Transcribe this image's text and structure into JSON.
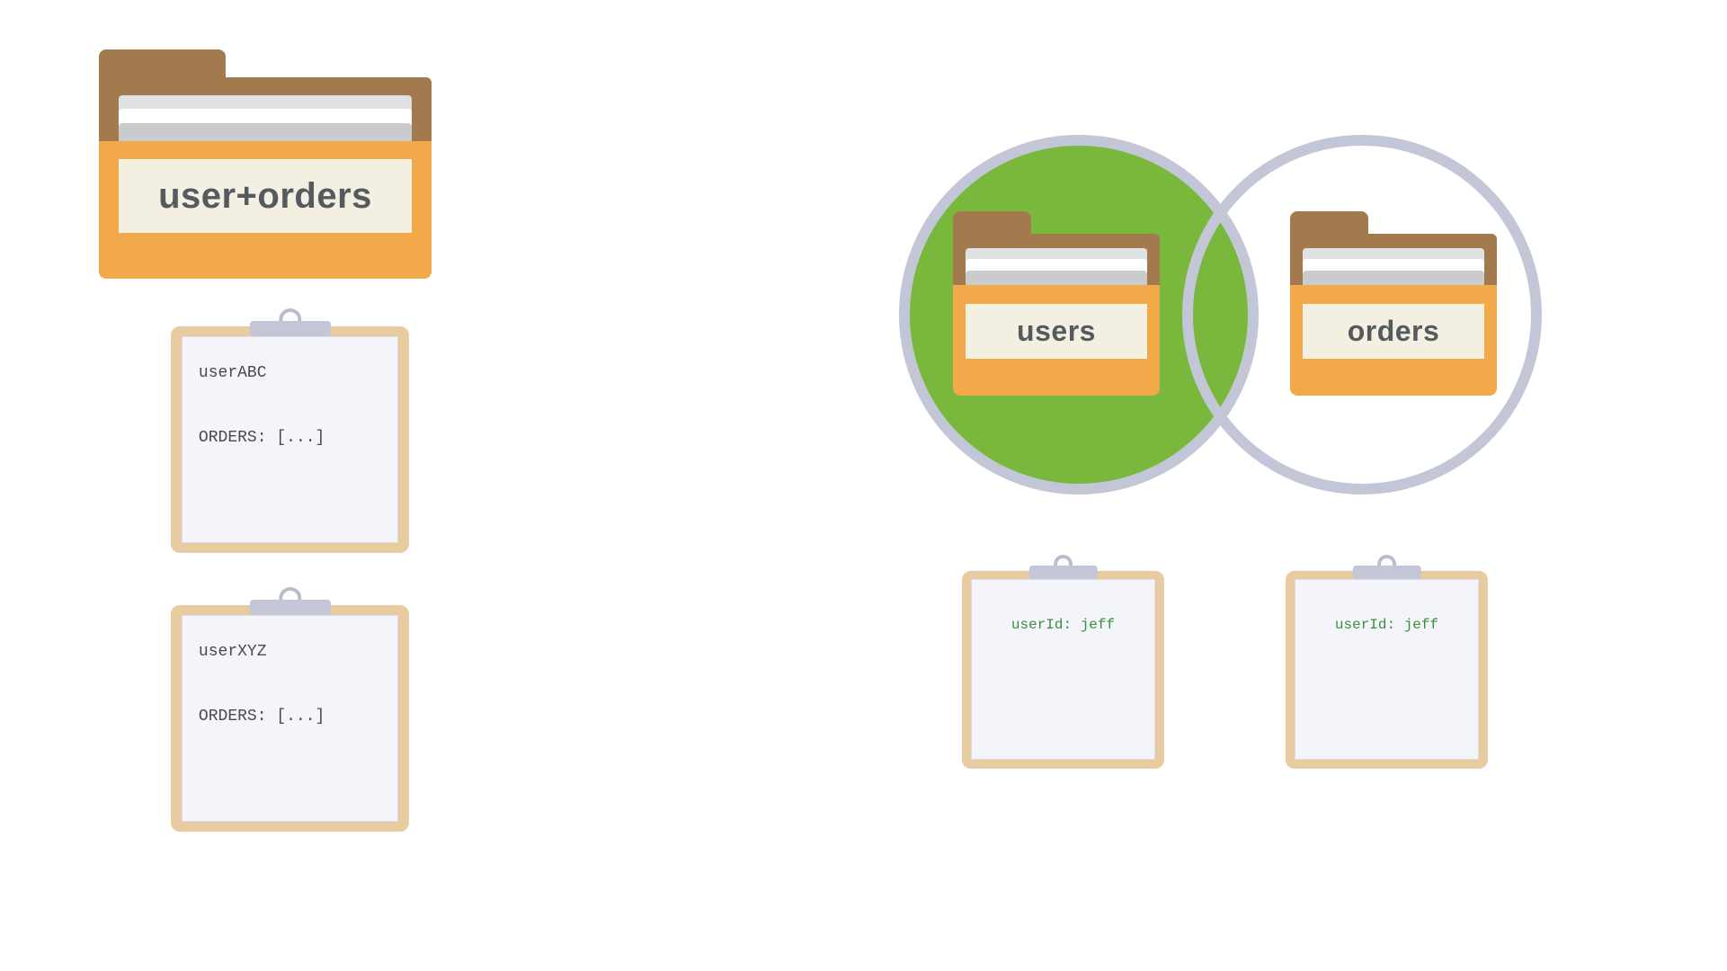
{
  "left": {
    "folder_label": "user+orders",
    "clipboards": [
      {
        "lines": "userABC\n\nORDERS: [...]"
      },
      {
        "lines": "userXYZ\n\nORDERS: [...]"
      }
    ]
  },
  "right": {
    "folders": {
      "users_label": "users",
      "orders_label": "orders"
    },
    "clipboards": [
      {
        "text": "userId: jeff"
      },
      {
        "text": "userId: jeff"
      }
    ]
  },
  "colors": {
    "folder_front": "#f2a94a",
    "folder_back": "#a37a4d",
    "venn_green": "#7ab83d",
    "venn_ring": "#c2c6d6",
    "clipboard": "#e9cba1",
    "page": "#f3f5fb"
  }
}
